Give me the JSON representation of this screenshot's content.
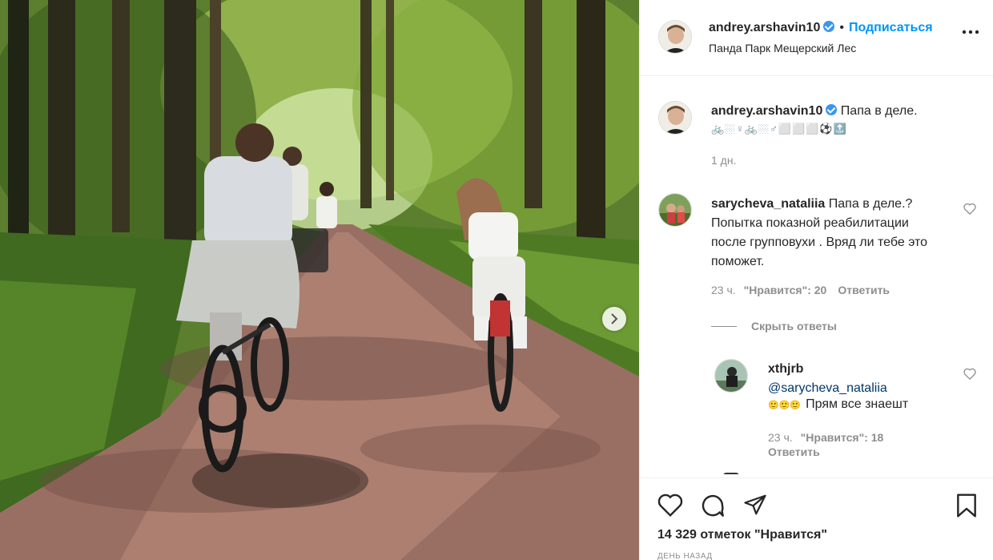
{
  "photo": {
    "alt": "Cyclists riding along a forest path"
  },
  "header": {
    "username": "andrey.arshavin10",
    "separator": "•",
    "follow_label": "Подписаться",
    "location": "Панда Парк Мещерский Лес"
  },
  "caption": {
    "username": "andrey.arshavin10",
    "text": "Папа в деле.",
    "emoji_line": "🚲🏼♀🚲🏼♂⬜⬜⬜⚽🔝",
    "time": "1 дн."
  },
  "comments": [
    {
      "username": "sarycheva_nataliia",
      "text": "Папа в деле.? Попытка показной реабилитации после групповухи . Вряд ли тебе это поможет.",
      "time": "23 ч.",
      "likes_label": "\"Нравится\": 20",
      "reply_label": "Ответить",
      "hide_replies_label": "Скрыть ответы"
    }
  ],
  "replies": [
    {
      "username": "xthjrb",
      "mention": "@sarycheva_nataliia",
      "faded": "🙂🙂🙂",
      "text": "Прям все знаешт",
      "time": "23 ч.",
      "likes_label": "\"Нравится\": 18",
      "reply_label": "Ответить"
    }
  ],
  "actions": {
    "likes_count": "14 329 отметок \"Нравится\"",
    "post_date": "день назад"
  },
  "colors": {
    "accent": "#0095f6",
    "verified": "#3897f0",
    "muted": "#8e8e8e",
    "text": "#262626"
  },
  "icons": [
    "more-icon",
    "heart-icon",
    "comment-icon",
    "share-icon",
    "bookmark-icon",
    "chevron-right-icon",
    "verified-icon"
  ]
}
